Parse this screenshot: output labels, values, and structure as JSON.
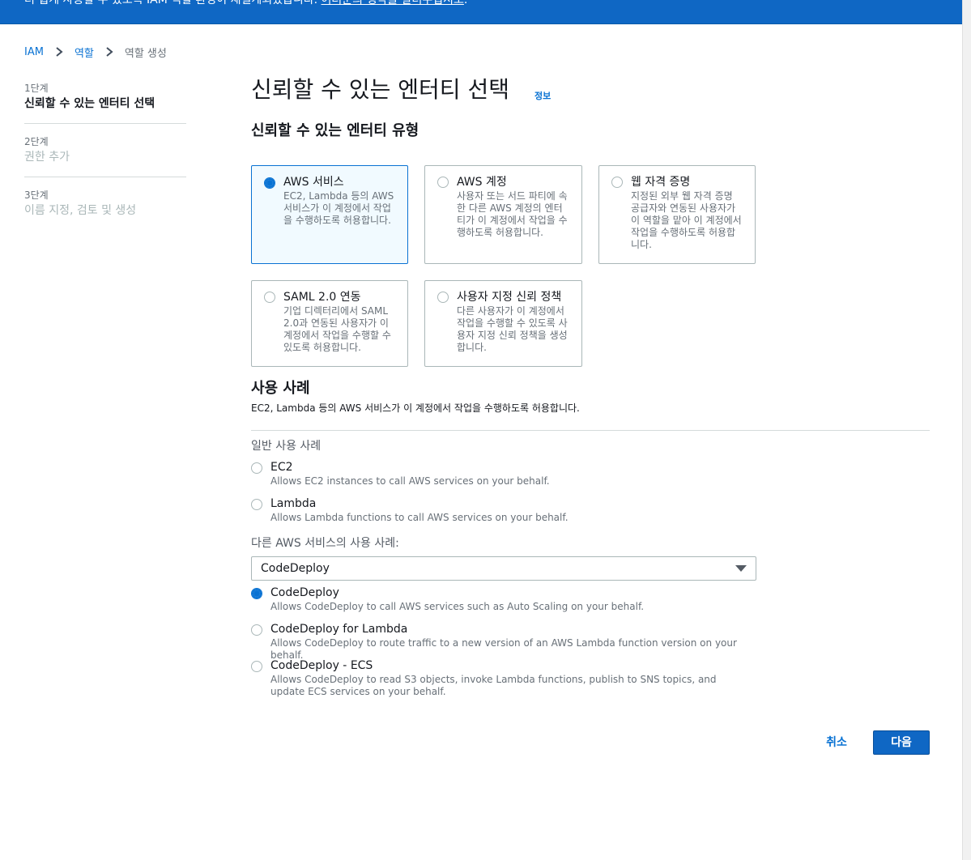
{
  "banner": {
    "text": "더 쉽게 사용할 수 있도록 IAM 역할 환경이 재설계되었습니다.",
    "link": "여러분의 생각을 알려주십시오",
    "suffix": "."
  },
  "breadcrumb": {
    "items": [
      "IAM",
      "역할"
    ],
    "current": "역할 생성"
  },
  "steps": [
    {
      "num": "1단계",
      "label": "신뢰할 수 있는 엔터티 선택",
      "active": true
    },
    {
      "num": "2단계",
      "label": "권한 추가",
      "active": false
    },
    {
      "num": "3단계",
      "label": "이름 지정, 검토 및 생성",
      "active": false
    }
  ],
  "page": {
    "title": "신뢰할 수 있는 엔터티 선택",
    "info": "정보",
    "subtitle": "신뢰할 수 있는 엔터티 유형"
  },
  "entity_types": [
    {
      "title": "AWS 서비스",
      "desc": "EC2, Lambda 등의 AWS 서비스가 이 계정에서 작업을 수행하도록 허용합니다.",
      "selected": true
    },
    {
      "title": "AWS 계정",
      "desc": "사용자 또는 서드 파티에 속한 다른 AWS 계정의 엔터티가 이 계정에서 작업을 수행하도록 허용합니다.",
      "selected": false
    },
    {
      "title": "웹 자격 증명",
      "desc": "지정된 외부 웹 자격 증명 공급자와 연동된 사용자가 이 역할을 맡아 이 계정에서 작업을 수행하도록 허용합니다.",
      "selected": false
    },
    {
      "title": "SAML 2.0 연동",
      "desc": "기업 디렉터리에서 SAML 2.0과 연동된 사용자가 이 계정에서 작업을 수행할 수 있도록 허용합니다.",
      "selected": false
    },
    {
      "title": "사용자 지정 신뢰 정책",
      "desc": "다른 사용자가 이 계정에서 작업을 수행할 수 있도록 사용자 지정 신뢰 정책을 생성합니다.",
      "selected": false
    }
  ],
  "use_case": {
    "heading": "사용 사례",
    "description": "EC2, Lambda 등의 AWS 서비스가 이 계정에서 작업을 수행하도록 허용합니다.",
    "common_label": "일반 사용 사례",
    "common": [
      {
        "title": "EC2",
        "desc": "Allows EC2 instances to call AWS services on your behalf.",
        "selected": false
      },
      {
        "title": "Lambda",
        "desc": "Allows Lambda functions to call AWS services on your behalf.",
        "selected": false
      }
    ],
    "other_label": "다른 AWS 서비스의 사용 사례:",
    "select_value": "CodeDeploy",
    "other": [
      {
        "title": "CodeDeploy",
        "desc": "Allows CodeDeploy to call AWS services such as Auto Scaling on your behalf.",
        "selected": true
      },
      {
        "title": "CodeDeploy for Lambda",
        "desc": "Allows CodeDeploy to route traffic to a new version of an AWS Lambda function version on your behalf.",
        "selected": false
      },
      {
        "title": "CodeDeploy - ECS",
        "desc": "Allows CodeDeploy to read S3 objects, invoke Lambda functions, publish to SNS topics, and update ECS services on your behalf.",
        "selected": false
      }
    ]
  },
  "actions": {
    "cancel": "취소",
    "next": "다음"
  },
  "colors": {
    "banner": "#0f67c4",
    "accent": "#0972d3",
    "selected_tile_bg": "#f1faff"
  }
}
